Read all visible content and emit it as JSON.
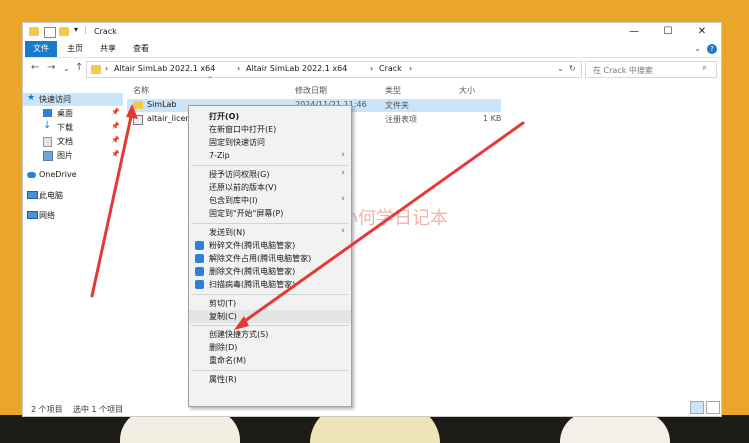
{
  "window": {
    "title": "Crack",
    "ribbon_tabs": [
      "文件",
      "主页",
      "共享",
      "查看"
    ],
    "help_label": "?"
  },
  "address": {
    "path": [
      "Altair SimLab 2022.1 x64",
      "Altair SimLab 2022.1 x64",
      "Crack"
    ],
    "search_placeholder": "在 Crack 中搜索"
  },
  "sidebar": {
    "items": [
      {
        "label": "快速访问",
        "icon": "star-icon",
        "selected": true,
        "pinned": false
      },
      {
        "label": "桌面",
        "icon": "desktop-icon",
        "selected": false,
        "pinned": true
      },
      {
        "label": "下载",
        "icon": "download-icon",
        "selected": false,
        "pinned": true
      },
      {
        "label": "文档",
        "icon": "document-icon",
        "selected": false,
        "pinned": true
      },
      {
        "label": "图片",
        "icon": "picture-icon",
        "selected": false,
        "pinned": true
      },
      {
        "label": "OneDrive",
        "icon": "cloud-icon",
        "selected": false,
        "pinned": false
      },
      {
        "label": "此电脑",
        "icon": "computer-icon",
        "selected": false,
        "pinned": false
      },
      {
        "label": "网络",
        "icon": "network-icon",
        "selected": false,
        "pinned": false
      }
    ],
    "pin_glyph": "📌"
  },
  "columns": [
    "名称",
    "修改日期",
    "类型",
    "大小"
  ],
  "files": [
    {
      "name": "SimLab",
      "date": "2024/11/21 11:46",
      "type": "文件夹",
      "size": "",
      "icon": "folder-icon",
      "selected": true
    },
    {
      "name": "altair_licens",
      "date": "",
      "type": "注册表项",
      "size": "1 KB",
      "icon": "registry-file-icon",
      "selected": false
    }
  ],
  "status": {
    "count": "2 个项目",
    "selected": "选中 1 个项目"
  },
  "context_menu": [
    {
      "label": "打开(O)",
      "bold": true,
      "arrow": false,
      "icon": ""
    },
    {
      "label": "在新窗口中打开(E)",
      "arrow": false,
      "icon": ""
    },
    {
      "label": "固定到快速访问",
      "arrow": false,
      "icon": ""
    },
    {
      "label": "7-Zip",
      "arrow": true,
      "icon": ""
    },
    {
      "sep": true
    },
    {
      "label": "授予访问权限(G)",
      "arrow": true,
      "icon": ""
    },
    {
      "label": "还原以前的版本(V)",
      "arrow": false,
      "icon": ""
    },
    {
      "label": "包含到库中(I)",
      "arrow": true,
      "icon": ""
    },
    {
      "label": "固定到\"开始\"屏幕(P)",
      "arrow": false,
      "icon": ""
    },
    {
      "sep": true
    },
    {
      "label": "发送到(N)",
      "arrow": true,
      "icon": ""
    },
    {
      "label": "粉碎文件(腾讯电脑管家)",
      "arrow": false,
      "icon": "shred-icon",
      "color": "#2f7fd8"
    },
    {
      "label": "解除文件占用(腾讯电脑管家)",
      "arrow": false,
      "icon": "unlock-icon",
      "color": "#2f7fd8"
    },
    {
      "label": "删除文件(腾讯电脑管家)",
      "arrow": false,
      "icon": "delete-icon",
      "color": "#2f7fd8"
    },
    {
      "label": "扫描病毒(腾讯电脑管家)",
      "arrow": false,
      "icon": "shield-icon",
      "color": "#2f7fd8"
    },
    {
      "sep": true
    },
    {
      "label": "剪切(T)",
      "arrow": false,
      "icon": ""
    },
    {
      "label": "复制(C)",
      "arrow": false,
      "icon": "",
      "hover": true
    },
    {
      "sep": true
    },
    {
      "label": "创建快捷方式(S)",
      "arrow": false,
      "icon": ""
    },
    {
      "label": "删除(D)",
      "arrow": false,
      "icon": ""
    },
    {
      "label": "重命名(M)",
      "arrow": false,
      "icon": ""
    },
    {
      "sep": true
    },
    {
      "label": "属性(R)",
      "arrow": false,
      "icon": ""
    }
  ],
  "watermark": "小何学日记本",
  "colors": {
    "accent": "#1979ca",
    "selection": "#cce4f7",
    "arrow": "#e53935",
    "background": "#e9a62b"
  }
}
